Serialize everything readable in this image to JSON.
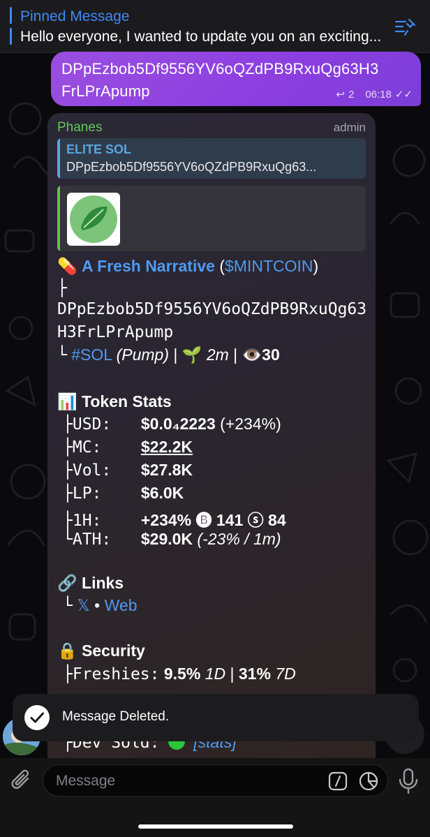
{
  "pinned": {
    "title": "Pinned Message",
    "text": "Hello everyone, I wanted to update you on an exciting..."
  },
  "outgoing": {
    "line1": "DPpEzbob5Df9556YV6oQZdPB9RxuQg63H3",
    "line2": "FrLPrApump",
    "reply_count": "2",
    "time": "06:18"
  },
  "incoming": {
    "sender": "Phanes",
    "role": "admin",
    "reply": {
      "title": "ELITE SOL",
      "snippet": "DPpEzbob5Df9556YV6oQZdPB9RxuQg63..."
    },
    "headline": {
      "emoji": "💊",
      "name": "A Fresh Narrative",
      "open_paren": " (",
      "ticker": "$MINTCOIN",
      "close_paren": ")"
    },
    "branch": "├",
    "contract_line1": "DPpEzbob5Df9556YV6oQZdPB9RxuQg63",
    "contract_line2": "H3FrLPrApump",
    "chain": {
      "tree": "└",
      "tag": "#SOL",
      "platform": "(Pump)",
      "sep1": " | ",
      "sprout": "🌱",
      "age": "2m",
      "sep2": " | ",
      "eye": "👁️",
      "views": "30"
    },
    "stats": {
      "emoji": "📊",
      "title": "Token Stats",
      "rows": [
        {
          "tree": "├",
          "key": "USD:",
          "value": "$0.0₄2223",
          "extra": " (+234%)"
        },
        {
          "tree": "├",
          "key": "MC:",
          "value": "$22.2K",
          "extra": ""
        },
        {
          "tree": "├",
          "key": "Vol:",
          "value": "$27.8K",
          "extra": ""
        },
        {
          "tree": "├",
          "key": "LP:",
          "value": "$6.0K",
          "extra": ""
        },
        {
          "tree": "├",
          "key": "1H:",
          "value": "+234%",
          "extra": " 🅑 141 ⓢ 84"
        },
        {
          "tree": "└",
          "key": "ATH:",
          "value": "$29.0K",
          "extra": " (-23% / 1m)"
        }
      ]
    },
    "links": {
      "emoji": "🔗",
      "title": "Links",
      "tree": "└",
      "x": "𝕏",
      "dot": " • ",
      "web": "Web"
    },
    "security": {
      "emoji": "🔒",
      "title": "Security",
      "freshies_tree": "├",
      "freshies_key": "Freshies:",
      "freshies_1d": "9.5%",
      "freshies_1d_label": "1D",
      "freshies_sep": " | ",
      "freshies_7d": "31%",
      "freshies_7d_label": "7D",
      "dev_tree": "├",
      "dev_key": "Dev Sold:",
      "dev_link": "[stats]"
    }
  },
  "toast": {
    "text": "Message Deleted."
  },
  "input": {
    "placeholder": "Message"
  },
  "colors": {
    "accent": "#3e88f7",
    "bubble_out": "#8c3ee0",
    "sender": "#65c65c",
    "link": "#4f9af0"
  }
}
